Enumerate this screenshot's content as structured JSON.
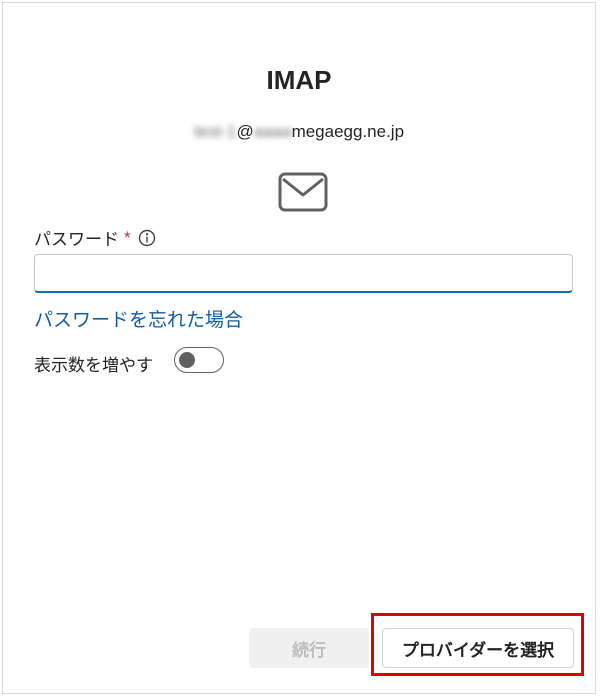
{
  "dialog": {
    "title": "IMAP",
    "account": {
      "user_blurred": "test-1",
      "at": "@",
      "domain_blurred": "aaaa",
      "domain": "megaegg.ne.jp"
    },
    "mail_icon": "envelope-icon"
  },
  "password": {
    "label": "パスワード",
    "required_mark": "*",
    "info_icon": "info-icon",
    "value": "",
    "placeholder": ""
  },
  "forgot_link": "パスワードを忘れた場合",
  "show_more": {
    "label": "表示数を増やす",
    "toggle_on": false
  },
  "footer": {
    "continue_label": "続行",
    "continue_enabled": false,
    "choose_provider_label": "プロバイダーを選択"
  },
  "colors": {
    "accent": "#0f6cbd",
    "link": "#115ea3",
    "required": "#c4314b",
    "highlight": "#e00000"
  }
}
